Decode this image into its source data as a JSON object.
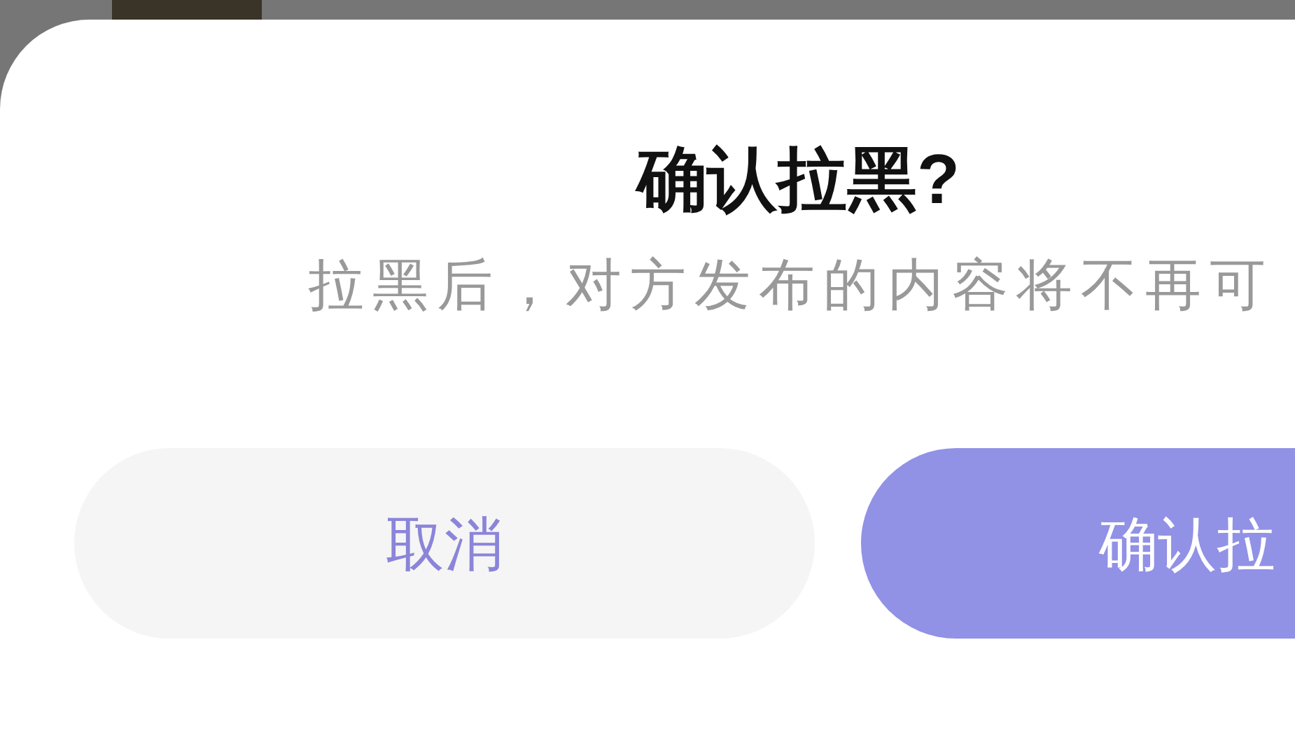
{
  "dialog": {
    "title": "确认拉黑?",
    "message": "拉黑后，对方发布的内容将不再可"
  },
  "buttons": [
    {
      "label": "取消",
      "kind": "secondary"
    },
    {
      "label": "确认拉",
      "kind": "primary"
    }
  ]
}
